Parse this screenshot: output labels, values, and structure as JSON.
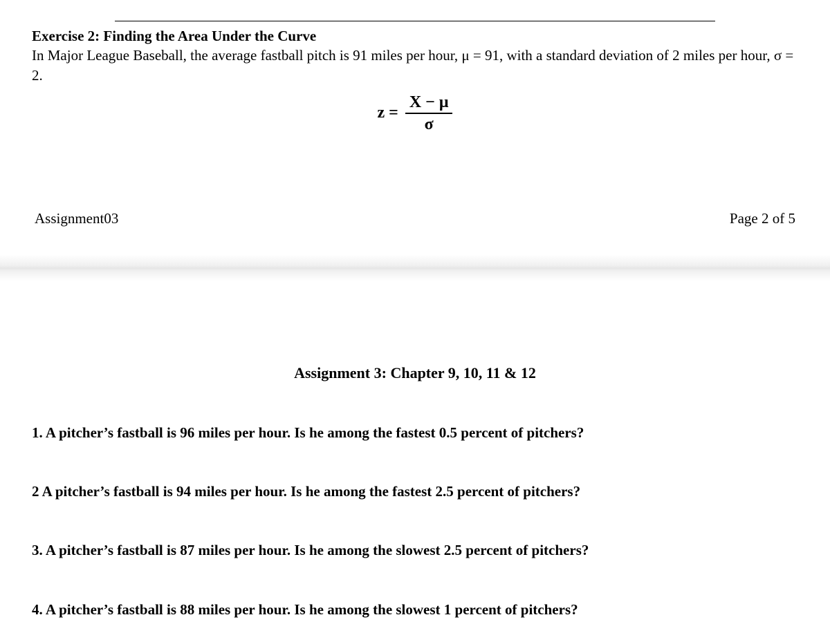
{
  "exercise": {
    "title": "Exercise 2: Finding the Area Under the Curve",
    "body": "In Major League Baseball, the average fastball pitch is 91 miles per hour, μ = 91, with a standard deviation of 2 miles per hour, σ = 2.",
    "formula": {
      "lhs": "z =",
      "numerator": "X − μ",
      "denominator": "σ"
    }
  },
  "footer": {
    "left": "Assignment03",
    "right": "Page 2 of 5"
  },
  "assignment": {
    "header": "Assignment 3: Chapter 9, 10, 11 & 12",
    "questions": [
      "1. A pitcher’s fastball is 96 miles per hour. Is he among the fastest 0.5 percent of pitchers?",
      "2 A pitcher’s fastball is 94 miles per hour. Is he among the fastest 2.5 percent of pitchers?",
      "3. A pitcher’s fastball is 87 miles per hour. Is he among the slowest 2.5 percent of pitchers?",
      "4. A pitcher’s fastball is 88 miles per hour. Is he among the slowest 1 percent of pitchers?"
    ]
  }
}
